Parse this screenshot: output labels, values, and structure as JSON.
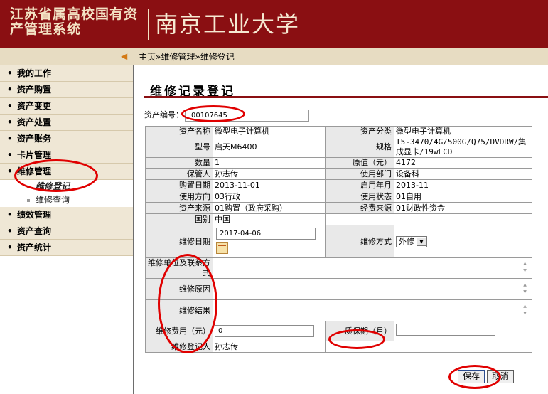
{
  "header": {
    "system_name": "江苏省属高校国有资产管理系统",
    "university": "南京工业大学"
  },
  "breadcrumb": {
    "home": "主页",
    "section": "维修管理",
    "page": "维修登记",
    "sep": "»"
  },
  "sidebar": {
    "items": [
      {
        "label": "我的工作",
        "name": "sidebar-item-my-work"
      },
      {
        "label": "资产购置",
        "name": "sidebar-item-asset-purchase"
      },
      {
        "label": "资产变更",
        "name": "sidebar-item-asset-change"
      },
      {
        "label": "资产处置",
        "name": "sidebar-item-asset-disposal"
      },
      {
        "label": "资产账务",
        "name": "sidebar-item-asset-accounts"
      },
      {
        "label": "卡片管理",
        "name": "sidebar-item-card-management"
      },
      {
        "label": "维修管理",
        "name": "sidebar-item-repair-management"
      },
      {
        "label": "绩效管理",
        "name": "sidebar-item-performance"
      },
      {
        "label": "资产查询",
        "name": "sidebar-item-asset-query"
      },
      {
        "label": "资产统计",
        "name": "sidebar-item-asset-statistics"
      }
    ],
    "sub_items": [
      {
        "label": "维修登记"
      },
      {
        "label": "维修查询"
      }
    ]
  },
  "form": {
    "title": "维修记录登记",
    "asset_no_label": "资产编号：",
    "asset_no_value": "00107645",
    "rows": {
      "name_label": "资产名称",
      "name_value": "微型电子计算机",
      "category_label": "资产分类",
      "category_value": "微型电子计算机",
      "model_label": "型号",
      "model_value": "启天M6400",
      "spec_label": "规格",
      "spec_value": "I5-3470/4G/500G/Q75/DVDRW/集成显卡/19wLCD",
      "qty_label": "数量",
      "qty_value": "1",
      "price_label": "原值（元）",
      "price_value": "4172",
      "keeper_label": "保管人",
      "keeper_value": "孙志传",
      "dept_label": "使用部门",
      "dept_value": "设备科",
      "purchase_date_label": "购置日期",
      "purchase_date_value": "2013-11-01",
      "start_month_label": "启用年月",
      "start_month_value": "2013-11",
      "direction_label": "使用方向",
      "direction_value": "03行政",
      "status_label": "使用状态",
      "status_value": "01自用",
      "source_label": "资产来源",
      "source_value": "01购置（政府采购）",
      "fund_label": "经费来源",
      "fund_value": "01财政性资金",
      "country_label": "国别",
      "country_value": "中国",
      "repair_date_label": "维修日期",
      "repair_date_value": "2017-04-06",
      "repair_mode_label": "维修方式",
      "repair_mode_value": "外修",
      "repair_unit_label": "维修单位及联系方式",
      "repair_reason_label": "维修原因",
      "repair_result_label": "维修结果",
      "repair_cost_label": "维修费用（元）",
      "repair_cost_value": "0",
      "warranty_label": "质保期（月）",
      "warranty_value": "",
      "registrant_label": "维修登记人",
      "registrant_value": "孙志传"
    },
    "save_label": "保存",
    "cancel_label": "取消"
  },
  "colors": {
    "header_bg": "#8a0f12",
    "nav_bg": "#efe7d5",
    "highlight": "#e00000"
  }
}
